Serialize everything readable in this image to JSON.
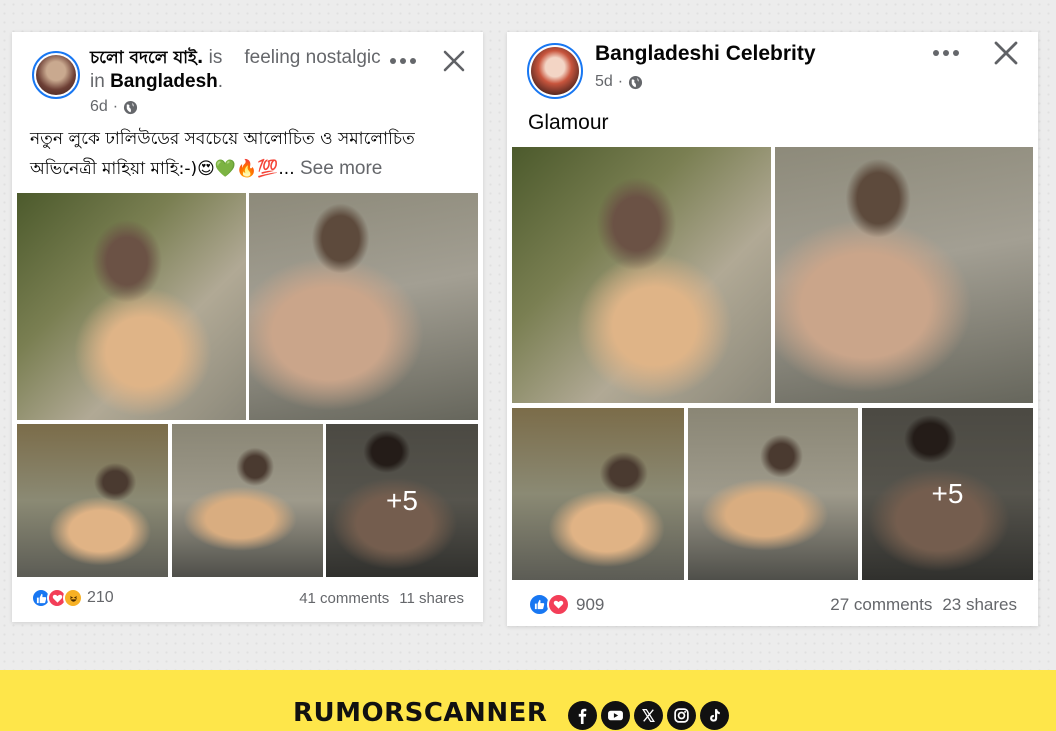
{
  "posts": [
    {
      "author": "চলো বদলে যাই.",
      "is_text": "is",
      "feeling_text": "feeling nostalgic in",
      "location": "Bangladesh",
      "location_suffix": ".",
      "time": "6d",
      "audience_icon": "globe-icon",
      "caption": "নতুন লুকে ঢালিউডের সবচেয়ে আলোচিত ও সমালোচিত অভিনেত্রী মাহিয়া মাহি:-)😍💚🔥💯...",
      "see_more": "See more",
      "photo_more_count": "+5",
      "reactions": [
        "like",
        "love",
        "haha"
      ],
      "reaction_count": "210",
      "comments": "41 comments",
      "shares": "11 shares"
    },
    {
      "author": "Bangladeshi Celebrity",
      "time": "5d",
      "audience_icon": "globe-icon",
      "caption": "Glamour",
      "photo_more_count": "+5",
      "reactions": [
        "like",
        "love"
      ],
      "reaction_count": "909",
      "comments": "27 comments",
      "shares": "23 shares"
    }
  ],
  "footer": {
    "brand": "RUMORSCANNER",
    "social_icons": [
      "facebook-icon",
      "youtube-icon",
      "x-icon",
      "instagram-icon",
      "tiktok-icon"
    ]
  },
  "colors": {
    "facebook_blue": "#1877f2",
    "love_red": "#f33e58",
    "haha_yellow": "#f7b125",
    "banner_yellow": "#fee64a",
    "meta_gray": "#65676b"
  }
}
